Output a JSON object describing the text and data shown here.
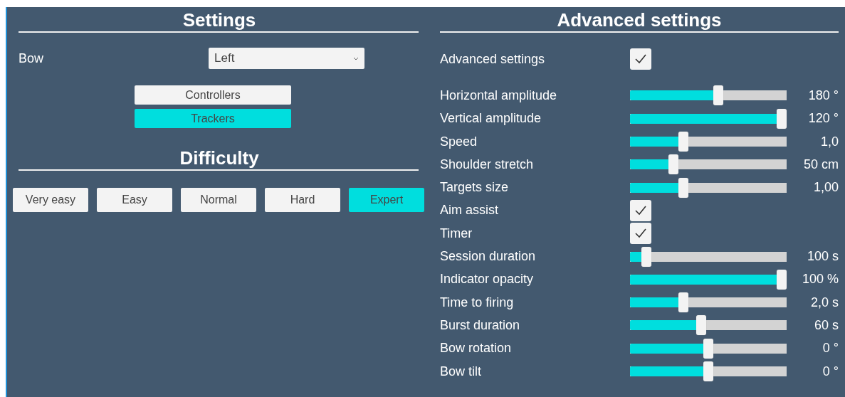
{
  "settings": {
    "title": "Settings",
    "bow": {
      "label": "Bow",
      "value": "Left"
    },
    "modes": [
      {
        "label": "Controllers",
        "selected": false
      },
      {
        "label": "Trackers",
        "selected": true
      }
    ]
  },
  "difficulty": {
    "title": "Difficulty",
    "options": [
      {
        "label": "Very easy",
        "selected": false
      },
      {
        "label": "Easy",
        "selected": false
      },
      {
        "label": "Normal",
        "selected": false
      },
      {
        "label": "Hard",
        "selected": false
      },
      {
        "label": "Expert",
        "selected": true
      }
    ]
  },
  "advanced": {
    "title": "Advanced settings",
    "toggle": {
      "label": "Advanced settings",
      "checked": true
    },
    "items": [
      {
        "kind": "slider",
        "label": "Horizontal amplitude",
        "level": 0.57,
        "reading": "180 °"
      },
      {
        "kind": "slider",
        "label": "Vertical amplitude",
        "level": 1.0,
        "reading": "120 °"
      },
      {
        "kind": "slider",
        "label": "Speed",
        "level": 0.33,
        "reading": "1,0"
      },
      {
        "kind": "slider",
        "label": "Shoulder stretch",
        "level": 0.26,
        "reading": "50 cm"
      },
      {
        "kind": "slider",
        "label": "Targets size",
        "level": 0.33,
        "reading": "1,00"
      },
      {
        "kind": "checkbox",
        "label": "Aim assist",
        "checked": true
      },
      {
        "kind": "checkbox",
        "label": "Timer",
        "checked": true
      },
      {
        "kind": "slider",
        "label": "Session duration",
        "level": 0.08,
        "reading": "100 s"
      },
      {
        "kind": "slider",
        "label": "Indicator opacity",
        "level": 1.0,
        "reading": "100 %"
      },
      {
        "kind": "slider",
        "label": "Time to firing",
        "level": 0.33,
        "reading": "2,0 s"
      },
      {
        "kind": "slider",
        "label": "Burst duration",
        "level": 0.45,
        "reading": "60 s"
      },
      {
        "kind": "slider",
        "label": "Bow rotation",
        "level": 0.5,
        "reading": "0 °"
      },
      {
        "kind": "slider",
        "label": "Bow tilt",
        "level": 0.5,
        "reading": "0 °"
      }
    ]
  }
}
